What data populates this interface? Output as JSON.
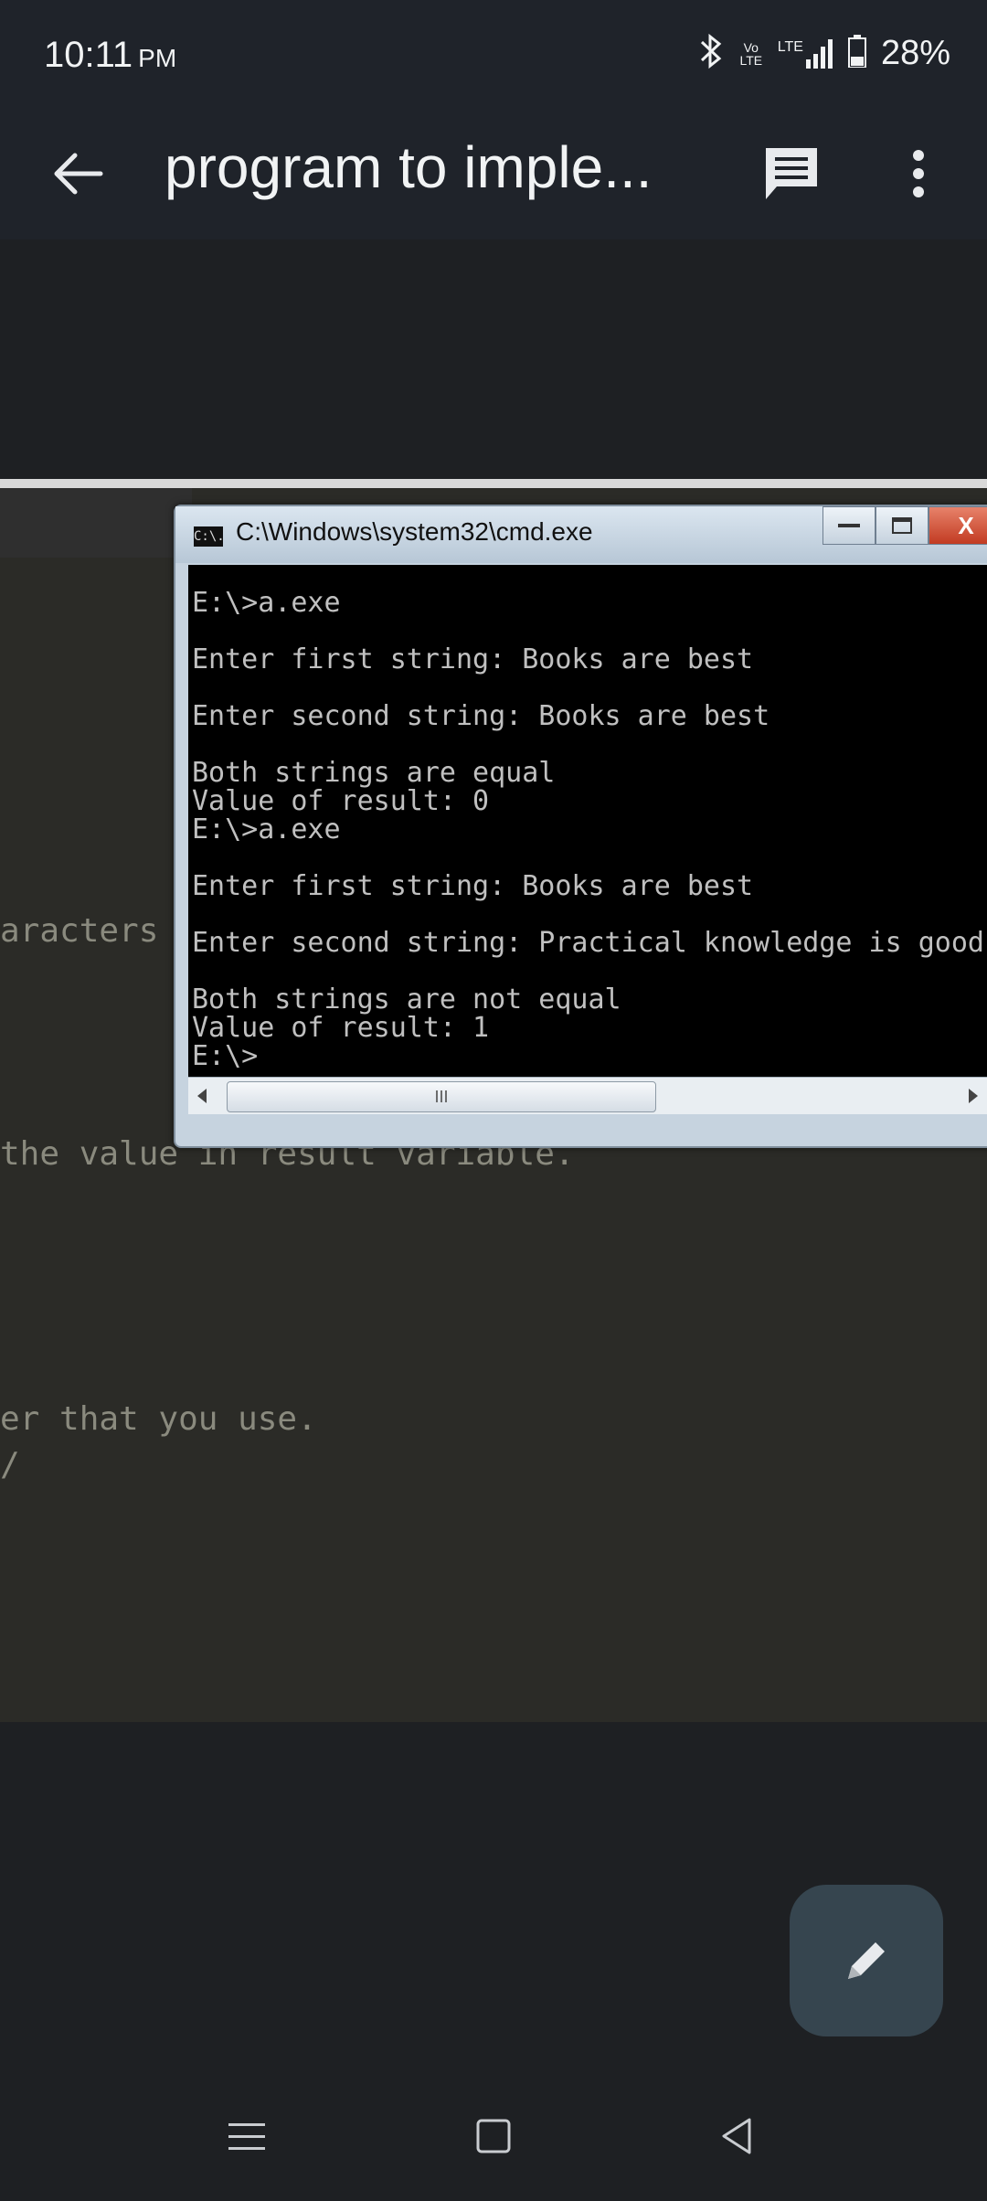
{
  "status": {
    "time": "10:11",
    "ampm": "PM",
    "battery": "28%",
    "lte": "LTE",
    "volte": "Vo LTE"
  },
  "app_bar": {
    "title": "program to imple..."
  },
  "document": {
    "code_fragments": [
      {
        "text": "aracters"
      },
      {
        "text": "the value in result variable."
      },
      {
        "text": "er that you use."
      },
      {
        "text": "/"
      }
    ]
  },
  "cmd": {
    "icon_text": "C:\\.",
    "title": "C:\\Windows\\system32\\cmd.exe",
    "min_label": "—",
    "close_label": "X",
    "thumb_grip": "III",
    "lines": [
      "E:\\>a.exe",
      "",
      "Enter first string: Books are best",
      "",
      "Enter second string: Books are best",
      "",
      "Both strings are equal",
      "Value of result: 0",
      "E:\\>a.exe",
      "",
      "Enter first string: Books are best",
      "",
      "Enter second string: Practical knowledge is good",
      "",
      "Both strings are not equal",
      "Value of result: 1",
      "E:\\>"
    ]
  },
  "colors": {
    "background": "#1e2023",
    "appbar": "#1f232a",
    "fab": "#36454f",
    "doc": "#2b2b27"
  }
}
